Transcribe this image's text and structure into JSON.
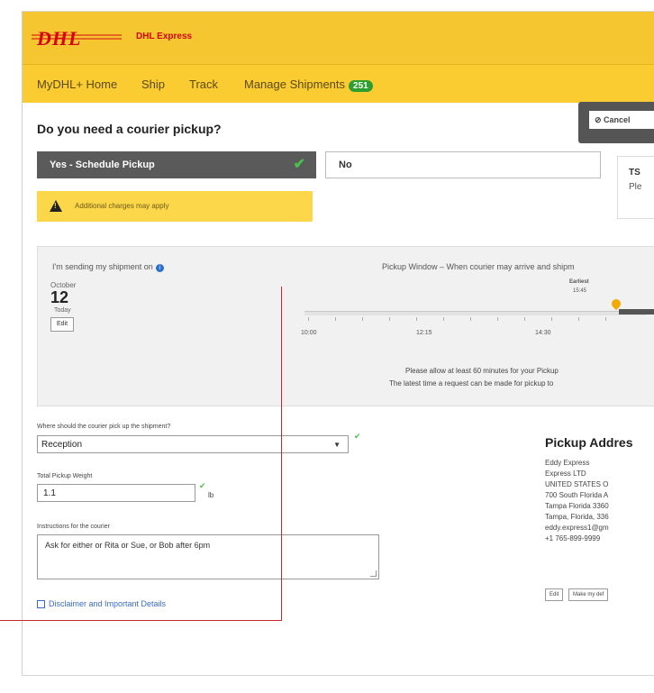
{
  "header": {
    "logo": "DHL",
    "brand": "DHL Express"
  },
  "nav": {
    "items": [
      "MyDHL+ Home",
      "Ship",
      "Track",
      "Manage Shipments"
    ],
    "badge": "251",
    "cancel_label": "Cancel"
  },
  "pickup": {
    "question": "Do you need a courier pickup?",
    "yes_label": "Yes - Schedule Pickup",
    "no_label": "No",
    "warning": "Additional charges may apply",
    "side_title": "TS",
    "side_sub": "Ple"
  },
  "schedule": {
    "sending_label": "I'm sending my shipment on",
    "month": "October",
    "day": "12",
    "today": "Today",
    "edit": "Edit",
    "window_title": "Pickup Window – When courier may arrive and shipm",
    "earliest_label": "Earliest",
    "earliest_time": "15:45",
    "ticks": [
      "10:00",
      "12:15",
      "14:30"
    ],
    "note1": "Please allow at least 60 minutes for your Pickup",
    "note2": "The latest time a request can be made for pickup to"
  },
  "form": {
    "location_label": "Where should the courier pick up the shipment?",
    "location_value": "Reception",
    "weight_label": "Total Pickup Weight",
    "weight_value": "1.1",
    "weight_unit": "lb",
    "instructions_label": "Instructions for the courier",
    "instructions_value": "Ask for either or Rita or Sue, or Bob after 6pm",
    "disclaimer": "Disclaimer and Important Details"
  },
  "address": {
    "title": "Pickup Addres",
    "lines": [
      "Eddy Express",
      "Express LTD",
      "UNITED STATES O",
      "700 South Florida A",
      "Tampa Florida 3360",
      "Tampa, Florida, 336",
      "eddy.express1@gm",
      "+1 765-899-9999"
    ],
    "edit": "Edit",
    "make_default": "Make my def"
  }
}
